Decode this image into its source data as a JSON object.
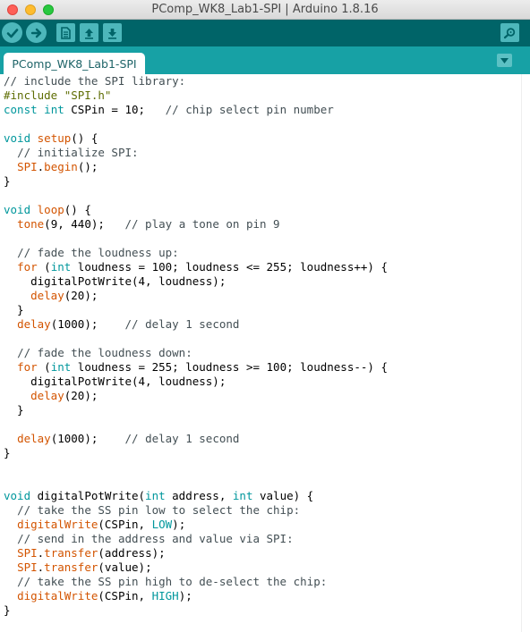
{
  "window": {
    "title": "PComp_WK8_Lab1-SPI | Arduino 1.8.16"
  },
  "toolbar": {
    "buttons": [
      {
        "name": "verify",
        "icon": "checkmark-icon"
      },
      {
        "name": "upload",
        "icon": "arrow-right-icon"
      },
      {
        "name": "new",
        "icon": "document-icon"
      },
      {
        "name": "open",
        "icon": "arrow-up-icon"
      },
      {
        "name": "save",
        "icon": "arrow-down-icon"
      },
      {
        "name": "serial-monitor",
        "icon": "magnifier-icon"
      }
    ]
  },
  "tabs": {
    "items": [
      {
        "label": "PComp_WK8_Lab1-SPI"
      }
    ],
    "menu_icon": "triangle-down-icon"
  },
  "colors": {
    "toolbar_bg": "#006468",
    "tabstrip_bg": "#17a1a5",
    "button_bg": "#4db7bb",
    "comment": "#434f54",
    "keyword": "#00979c",
    "function": "#d35400",
    "preprocessor": "#5e6d03"
  },
  "code_lines": [
    [
      {
        "t": "// include the SPI library:",
        "c": "cm"
      }
    ],
    [
      {
        "t": "#include \"SPI.h\"",
        "c": "pp"
      }
    ],
    [
      {
        "t": "const",
        "c": "kw"
      },
      {
        "t": " "
      },
      {
        "t": "int",
        "c": "kw"
      },
      {
        "t": " CSPin = 10;   "
      },
      {
        "t": "// chip select pin number",
        "c": "cm"
      }
    ],
    [],
    [
      {
        "t": "void",
        "c": "kw"
      },
      {
        "t": " "
      },
      {
        "t": "setup",
        "c": "fn"
      },
      {
        "t": "() {"
      }
    ],
    [
      {
        "t": "  "
      },
      {
        "t": "// initialize SPI:",
        "c": "cm"
      }
    ],
    [
      {
        "t": "  "
      },
      {
        "t": "SPI",
        "c": "fn"
      },
      {
        "t": "."
      },
      {
        "t": "begin",
        "c": "fn"
      },
      {
        "t": "();"
      }
    ],
    [
      {
        "t": "}"
      }
    ],
    [],
    [
      {
        "t": "void",
        "c": "kw"
      },
      {
        "t": " "
      },
      {
        "t": "loop",
        "c": "fn"
      },
      {
        "t": "() {"
      }
    ],
    [
      {
        "t": "  "
      },
      {
        "t": "tone",
        "c": "fn"
      },
      {
        "t": "(9, 440);   "
      },
      {
        "t": "// play a tone on pin 9",
        "c": "cm"
      }
    ],
    [],
    [
      {
        "t": "  "
      },
      {
        "t": "// fade the loudness up:",
        "c": "cm"
      }
    ],
    [
      {
        "t": "  "
      },
      {
        "t": "for",
        "c": "fn"
      },
      {
        "t": " ("
      },
      {
        "t": "int",
        "c": "kw"
      },
      {
        "t": " loudness = 100; loudness <= 255; loudness++) {"
      }
    ],
    [
      {
        "t": "    digitalPotWrite(4, loudness);"
      }
    ],
    [
      {
        "t": "    "
      },
      {
        "t": "delay",
        "c": "fn"
      },
      {
        "t": "(20);"
      }
    ],
    [
      {
        "t": "  }"
      }
    ],
    [
      {
        "t": "  "
      },
      {
        "t": "delay",
        "c": "fn"
      },
      {
        "t": "(1000);    "
      },
      {
        "t": "// delay 1 second",
        "c": "cm"
      }
    ],
    [],
    [
      {
        "t": "  "
      },
      {
        "t": "// fade the loudness down:",
        "c": "cm"
      }
    ],
    [
      {
        "t": "  "
      },
      {
        "t": "for",
        "c": "fn"
      },
      {
        "t": " ("
      },
      {
        "t": "int",
        "c": "kw"
      },
      {
        "t": " loudness = 255; loudness >= 100; loudness--) {"
      }
    ],
    [
      {
        "t": "    digitalPotWrite(4, loudness);"
      }
    ],
    [
      {
        "t": "    "
      },
      {
        "t": "delay",
        "c": "fn"
      },
      {
        "t": "(20);"
      }
    ],
    [
      {
        "t": "  }"
      }
    ],
    [],
    [
      {
        "t": "  "
      },
      {
        "t": "delay",
        "c": "fn"
      },
      {
        "t": "(1000);    "
      },
      {
        "t": "// delay 1 second",
        "c": "cm"
      }
    ],
    [
      {
        "t": "}"
      }
    ],
    [],
    [],
    [
      {
        "t": "void",
        "c": "kw"
      },
      {
        "t": " digitalPotWrite("
      },
      {
        "t": "int",
        "c": "kw"
      },
      {
        "t": " address, "
      },
      {
        "t": "int",
        "c": "kw"
      },
      {
        "t": " value) {"
      }
    ],
    [
      {
        "t": "  "
      },
      {
        "t": "// take the SS pin low to select the chip:",
        "c": "cm"
      }
    ],
    [
      {
        "t": "  "
      },
      {
        "t": "digitalWrite",
        "c": "fn"
      },
      {
        "t": "(CSPin, "
      },
      {
        "t": "LOW",
        "c": "cst"
      },
      {
        "t": ");"
      }
    ],
    [
      {
        "t": "  "
      },
      {
        "t": "// send in the address and value via SPI:",
        "c": "cm"
      }
    ],
    [
      {
        "t": "  "
      },
      {
        "t": "SPI",
        "c": "fn"
      },
      {
        "t": "."
      },
      {
        "t": "transfer",
        "c": "fn"
      },
      {
        "t": "(address);"
      }
    ],
    [
      {
        "t": "  "
      },
      {
        "t": "SPI",
        "c": "fn"
      },
      {
        "t": "."
      },
      {
        "t": "transfer",
        "c": "fn"
      },
      {
        "t": "(value);"
      }
    ],
    [
      {
        "t": "  "
      },
      {
        "t": "// take the SS pin high to de-select the chip:",
        "c": "cm"
      }
    ],
    [
      {
        "t": "  "
      },
      {
        "t": "digitalWrite",
        "c": "fn"
      },
      {
        "t": "(CSPin, "
      },
      {
        "t": "HIGH",
        "c": "cst"
      },
      {
        "t": ");"
      }
    ],
    [
      {
        "t": "}"
      }
    ]
  ]
}
